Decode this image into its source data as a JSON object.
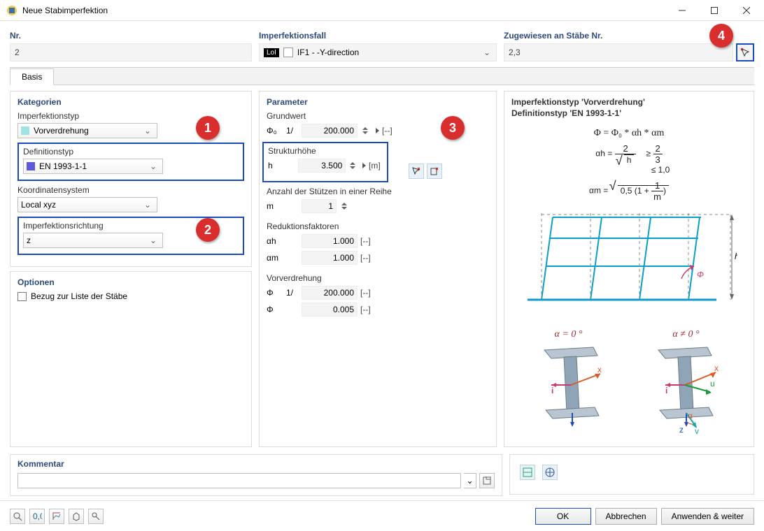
{
  "window": {
    "title": "Neue Stabimperfektion"
  },
  "top": {
    "nr_label": "Nr.",
    "nr_value": "2",
    "case_label": "Imperfektionsfall",
    "case_badge": "LoI",
    "case_value": "IF1 - -Y-direction",
    "assigned_label": "Zugewiesen an Stäbe Nr.",
    "assigned_value": "2,3"
  },
  "tabs": {
    "basis": "Basis"
  },
  "cat": {
    "header": "Kategorien",
    "imptype_label": "Imperfektionstyp",
    "imptype_value": "Vorverdrehung",
    "deftype_label": "Definitionstyp",
    "deftype_value": "EN 1993-1-1",
    "coord_label": "Koordinatensystem",
    "coord_value": "Local xyz",
    "dir_label": "Imperfektionsrichtung",
    "dir_value": "z"
  },
  "opt": {
    "header": "Optionen",
    "chk_label": "Bezug zur Liste der Stäbe"
  },
  "param": {
    "header": "Parameter",
    "base_label": "Grundwert",
    "phi0_sym": "Φ₀",
    "one_over": "1/",
    "phi0_val": "200.000",
    "unit_dimless": "[-]",
    "unit_dimless2": "[--]",
    "height_label": "Strukturhöhe",
    "h_sym": "h",
    "h_val": "3.500",
    "h_unit": "[m]",
    "cols_label": "Anzahl der Stützen in einer Reihe",
    "m_sym": "m",
    "m_val": "1",
    "red_label": "Reduktionsfaktoren",
    "ah_sym": "αh",
    "ah_val": "1.000",
    "am_sym": "αm",
    "am_val": "1.000",
    "sway_label": "Vorverdrehung",
    "phi_sym": "Φ",
    "phi_inv_val": "200.000",
    "phi_val": "0.005"
  },
  "info": {
    "line1": "Imperfektionstyp 'Vorverdrehung'",
    "line2": "Definitionstyp 'EN 1993-1-1'",
    "eq1": "Φ = Φ₀ * αh * αm",
    "eq2a": "αh =",
    "eq_ge": "≥",
    "eq_le": "≤ 1,0",
    "eq3a": "αm =",
    "alpha_eq0": "α = 0 °",
    "alpha_ne0": "α ≠ 0 °"
  },
  "comment": {
    "header": "Kommentar",
    "value": ""
  },
  "buttons": {
    "ok": "OK",
    "cancel": "Abbrechen",
    "apply": "Anwenden & weiter"
  },
  "callouts": {
    "c1": "1",
    "c2": "2",
    "c3": "3",
    "c4": "4"
  }
}
